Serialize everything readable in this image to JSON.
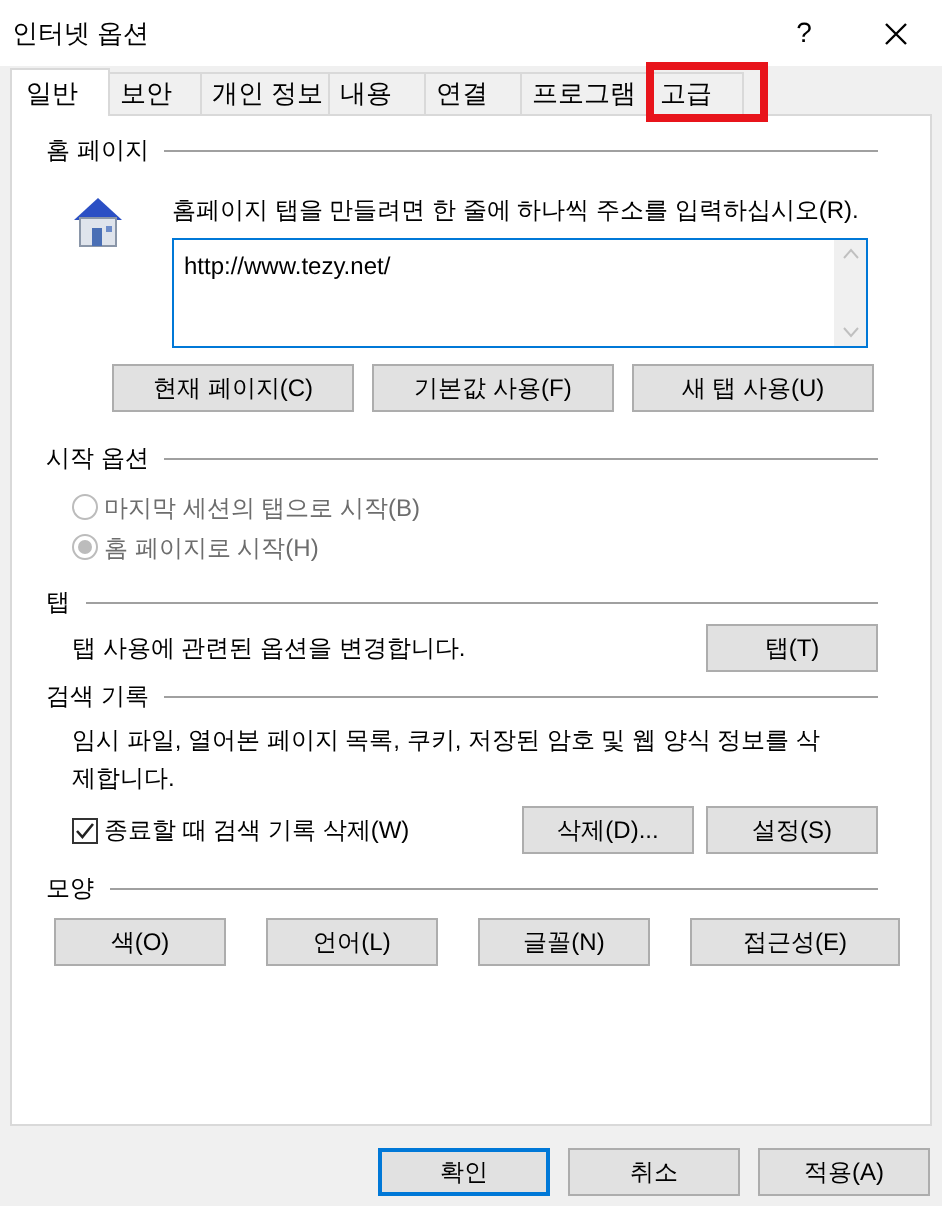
{
  "window": {
    "title": "인터넷 옵션",
    "help": "?"
  },
  "tabs": [
    {
      "label": "일반",
      "selected": true,
      "highlighted": false
    },
    {
      "label": "보안",
      "selected": false,
      "highlighted": false
    },
    {
      "label": "개인 정보",
      "selected": false,
      "highlighted": false
    },
    {
      "label": "내용",
      "selected": false,
      "highlighted": false
    },
    {
      "label": "연결",
      "selected": false,
      "highlighted": false
    },
    {
      "label": "프로그램",
      "selected": false,
      "highlighted": false
    },
    {
      "label": "고급",
      "selected": false,
      "highlighted": true
    }
  ],
  "home_page": {
    "heading": "홈 페이지",
    "instruction": "홈페이지 탭을 만들려면 한 줄에 하나씩 주소를 입력하십시오(R).",
    "value": "http://www.tezy.net/",
    "buttons": [
      "현재 페이지(C)",
      "기본값 사용(F)",
      "새 탭 사용(U)"
    ]
  },
  "startup": {
    "heading": "시작 옵션",
    "options": [
      {
        "label": "마지막 세션의 탭으로 시작(B)",
        "selected": false,
        "disabled": true
      },
      {
        "label": "홈 페이지로 시작(H)",
        "selected": true,
        "disabled": true
      }
    ]
  },
  "tabs_section": {
    "heading": "탭",
    "description": "탭 사용에 관련된 옵션을 변경합니다.",
    "button": "탭(T)"
  },
  "history": {
    "heading": "검색 기록",
    "description": "임시 파일, 열어본 페이지 목록, 쿠키, 저장된 암호 및 웹 양식 정보를 삭제합니다.",
    "checkbox": {
      "label": "종료할 때 검색 기록 삭제(W)",
      "checked": true
    },
    "buttons": [
      "삭제(D)...",
      "설정(S)"
    ]
  },
  "appearance": {
    "heading": "모양",
    "buttons": [
      "색(O)",
      "언어(L)",
      "글꼴(N)",
      "접근성(E)"
    ]
  },
  "footer_buttons": [
    {
      "label": "확인",
      "default": true
    },
    {
      "label": "취소",
      "default": false
    },
    {
      "label": "적용(A)",
      "default": false
    }
  ]
}
